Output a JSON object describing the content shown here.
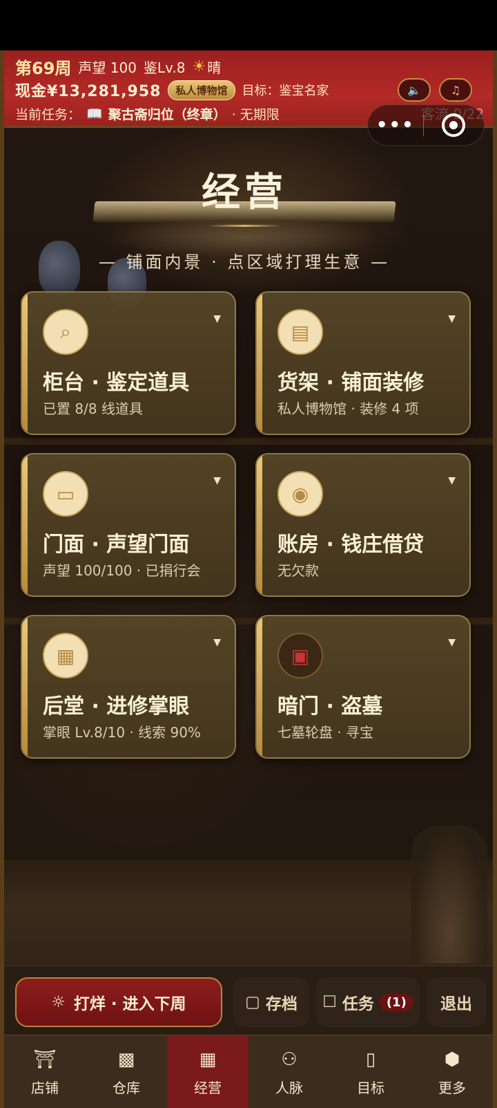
{
  "header": {
    "week": "第69周",
    "reputation": "声望 100",
    "appraisal_level": "鉴Lv.8",
    "weather": "晴",
    "cash": "现金¥13,281,958",
    "shop_badge": "私人博物馆",
    "goal": "目标：鉴宝名家",
    "task_prefix": "当前任务：",
    "task_name": "聚古斋归位（终章）",
    "task_deadline": "· 无期限",
    "traffic": "客流 0/22"
  },
  "page": {
    "title": "经营",
    "subtitle": "— 铺面内景 · 点区域打理生意 —"
  },
  "cards": [
    {
      "title": "柜台 · 鉴定道具",
      "sub": "已置 8/8 线道具",
      "icon": "magnifier-icon"
    },
    {
      "title": "货架 · 铺面装修",
      "sub": "私人博物馆 · 装修 4 项",
      "icon": "shelf-icon"
    },
    {
      "title": "门面 · 声望门面",
      "sub": "声望 100/100 · 已捐行会",
      "icon": "scroll-icon"
    },
    {
      "title": "账房 · 钱庄借贷",
      "sub": "无欠款",
      "icon": "money-bag-icon"
    },
    {
      "title": "后堂 · 进修掌眼",
      "sub": "掌眼 Lv.8/10 · 线索 90%",
      "icon": "map-icon"
    },
    {
      "title": "暗门 · 盗墓",
      "sub": "七墓轮盘 · 寻宝",
      "icon": "treasure-chest-icon"
    }
  ],
  "actions": {
    "next_week": "打烊 · 进入下周",
    "save": "存档",
    "tasks": "任务",
    "tasks_count": "(1)",
    "exit": "退出"
  },
  "tabs": [
    {
      "label": "店铺",
      "icon": "shop-icon"
    },
    {
      "label": "仓库",
      "icon": "warehouse-icon"
    },
    {
      "label": "经营",
      "icon": "abacus-icon",
      "active": true
    },
    {
      "label": "人脉",
      "icon": "people-icon"
    },
    {
      "label": "目标",
      "icon": "scroll-target-icon"
    },
    {
      "label": "更多",
      "icon": "more-icon"
    }
  ],
  "colors": {
    "header_red": "#b22a27",
    "gold": "#e9c877",
    "active_tab": "#7a1a1a"
  }
}
